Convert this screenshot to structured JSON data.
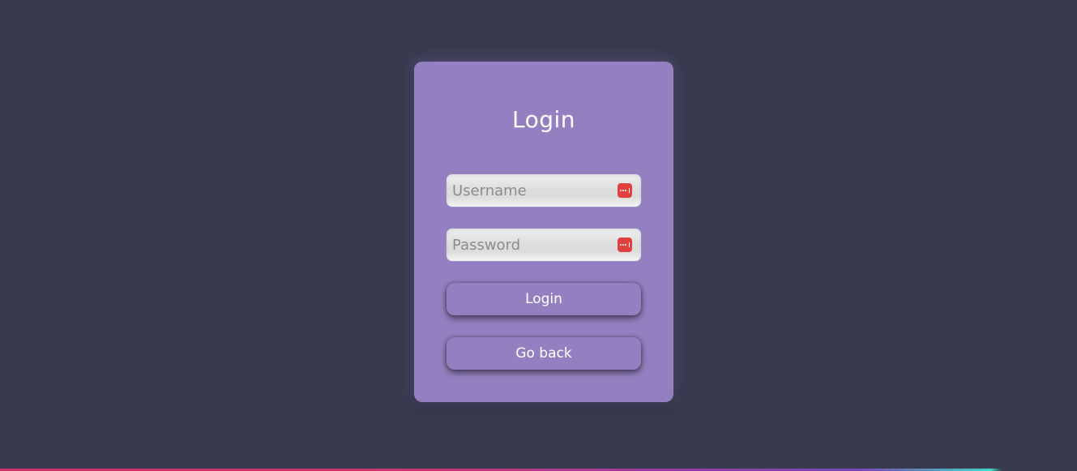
{
  "login_card": {
    "title": "Login",
    "username": {
      "placeholder": "Username",
      "value": ""
    },
    "password": {
      "placeholder": "Password",
      "value": ""
    },
    "login_button_label": "Login",
    "go_back_button_label": "Go back",
    "password_manager_icon": "password-manager-key-icon"
  },
  "colors": {
    "background": "#383b4f",
    "card": "#9480c0",
    "button": "#9480c0",
    "icon_red": "#e04040",
    "text": "#ffffff"
  }
}
